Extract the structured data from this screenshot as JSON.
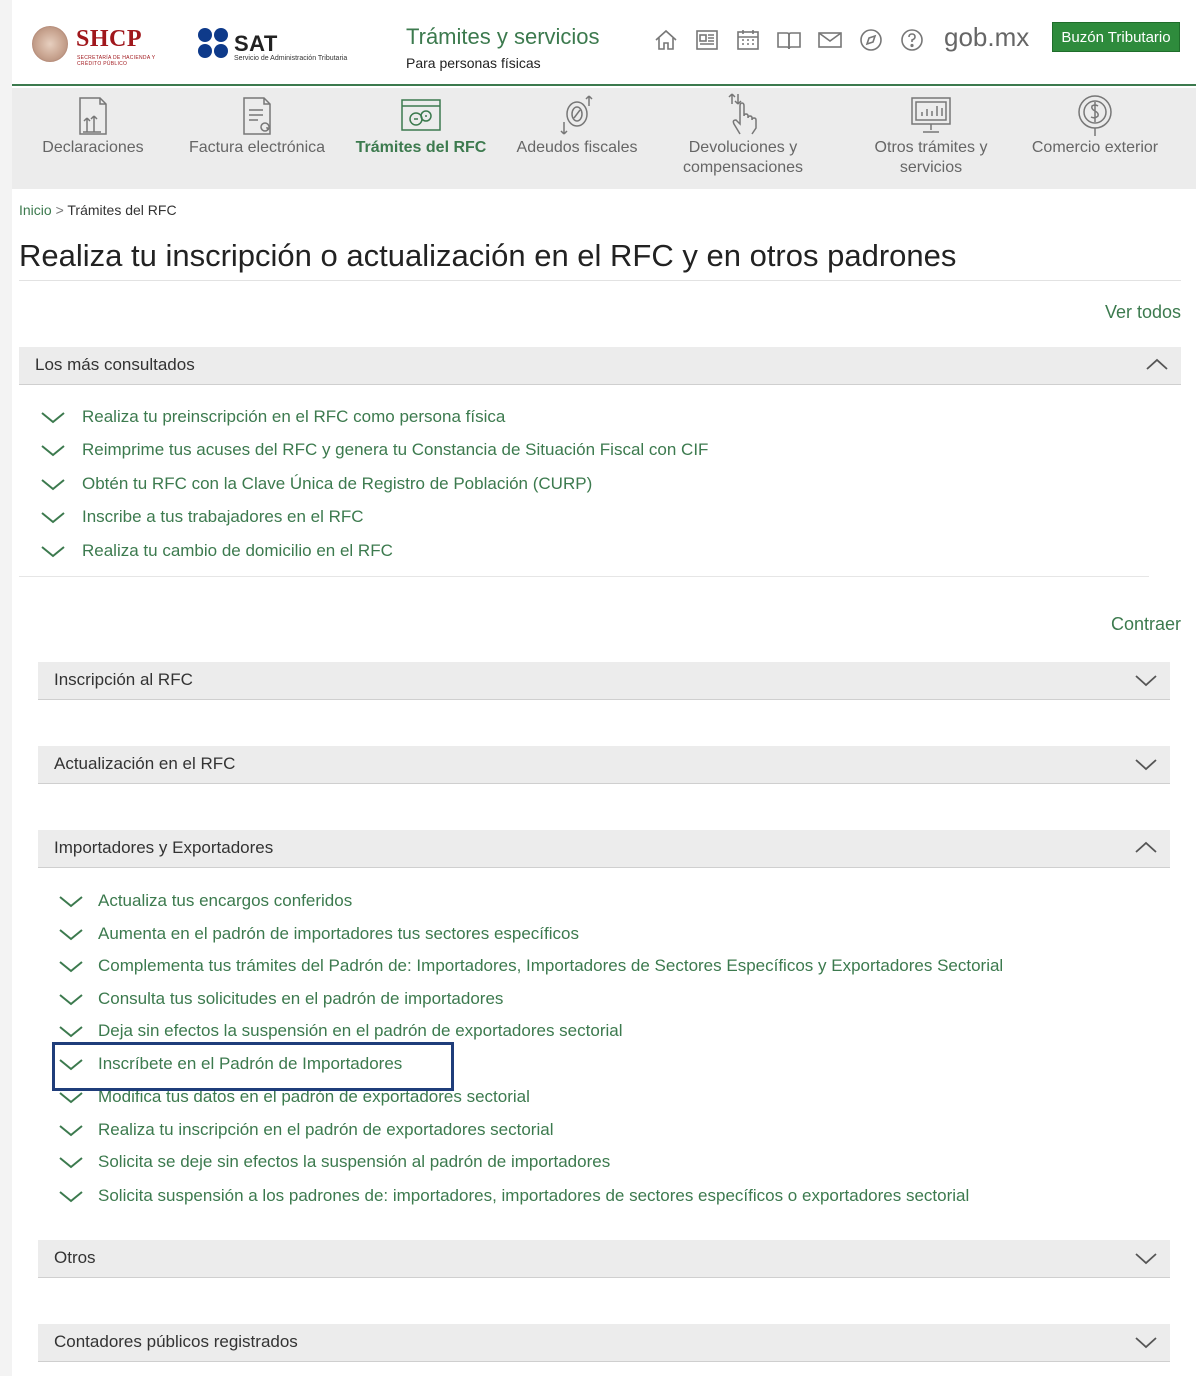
{
  "header": {
    "shcp_name": "SHCP",
    "shcp_subtitle": "SECRETARÍA DE HACIENDA Y CRÉDITO PÚBLICO",
    "sat_name": "SAT",
    "sat_subtitle": "Servicio de Administración Tributaria",
    "title": "Trámites y servicios",
    "subtitle": "Para personas físicas",
    "icons": [
      "home-icon",
      "news-icon",
      "calendar-icon",
      "book-icon",
      "mail-icon",
      "compass-icon",
      "help-icon"
    ],
    "gob_label": "gob.mx",
    "buzon_label": "Buzón Tributario"
  },
  "nav": {
    "items": [
      {
        "label": "Declaraciones",
        "icon": "declaraciones-icon"
      },
      {
        "label": "Factura electrónica",
        "icon": "factura-icon"
      },
      {
        "label": "Trámites del RFC",
        "icon": "rfc-icon",
        "active": true
      },
      {
        "label": "Adeudos fiscales",
        "icon": "adeudos-icon"
      },
      {
        "label": "Devoluciones y compensaciones",
        "icon": "devoluciones-icon"
      },
      {
        "label": "Otros trámites y servicios",
        "icon": "otros-tramites-icon"
      },
      {
        "label": "Comercio exterior",
        "icon": "comercio-exterior-icon"
      }
    ]
  },
  "breadcrumb": {
    "home": "Inicio",
    "separator": " > ",
    "current": "Trámites del RFC"
  },
  "page_title": "Realiza tu inscripción o actualización en el RFC y en otros padrones",
  "ver_todos": "Ver todos",
  "mas_consultados": {
    "title": "Los más consultados",
    "items": [
      "Realiza tu preinscripción en el RFC como persona física",
      "Reimprime tus acuses del RFC y genera tu Constancia de Situación Fiscal con CIF",
      "Obtén tu RFC con la Clave Única de Registro de Población (CURP)",
      "Inscribe a tus trabajadores en el RFC",
      "Realiza tu cambio de domicilio en el RFC"
    ]
  },
  "contraer": "Contraer",
  "sections": [
    {
      "title": "Inscripción al RFC",
      "expanded": false
    },
    {
      "title": "Actualización en el RFC",
      "expanded": false
    },
    {
      "title": "Importadores y Exportadores",
      "expanded": true
    },
    {
      "title": "Otros",
      "expanded": false
    },
    {
      "title": "Contadores públicos registrados",
      "expanded": false
    }
  ],
  "importadores_items": [
    "Actualiza tus encargos conferidos",
    "Aumenta en el padrón de importadores tus sectores específicos",
    "Complementa tus trámites del Padrón de: Importadores, Importadores de Sectores Específicos y Exportadores Sectorial",
    "Consulta tus solicitudes en el padrón de importadores",
    "Deja sin efectos la suspensión en el padrón de exportadores sectorial",
    "Inscríbete en el Padrón de Importadores",
    "Modifica tus datos en el padrón de exportadores sectorial",
    "Realiza tu inscripción en el padrón de exportadores sectorial",
    "Solicita se deje sin efectos la suspensión al padrón de importadores",
    "Solicita suspensión a los padrones de: importadores, importadores de sectores específicos o exportadores sectorial"
  ],
  "colors": {
    "accent": "#3c7a4e",
    "button": "#2e8b3c",
    "highlight_border": "#1f3d7a",
    "shcp_red": "#a0171c"
  }
}
